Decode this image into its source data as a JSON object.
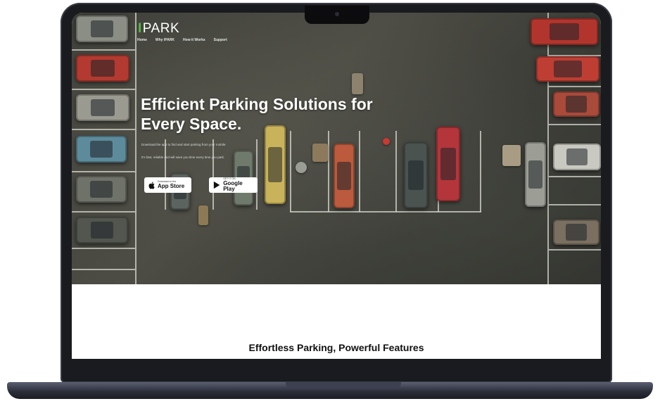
{
  "brand": {
    "logo_text": "PARK",
    "accent": "#4cbe3c"
  },
  "nav": {
    "items": [
      "Home",
      "Why IPARK",
      "How it Works",
      "Support"
    ]
  },
  "hero": {
    "headline": "Efficient Parking Solutions for Every Space.",
    "subtext_1": "Download the app to find and start parking from your mobile.",
    "subtext_2": "It's fast, reliable and will save you time every time you park.",
    "app_store": {
      "small": "Download on the",
      "big": "App Store"
    },
    "google_play": {
      "small": "GET IT ON",
      "big": "Google Play"
    }
  },
  "features": {
    "title": "Effortless Parking, Powerful Features"
  },
  "icons": {
    "apple": "apple-icon",
    "play": "play-store-icon"
  }
}
